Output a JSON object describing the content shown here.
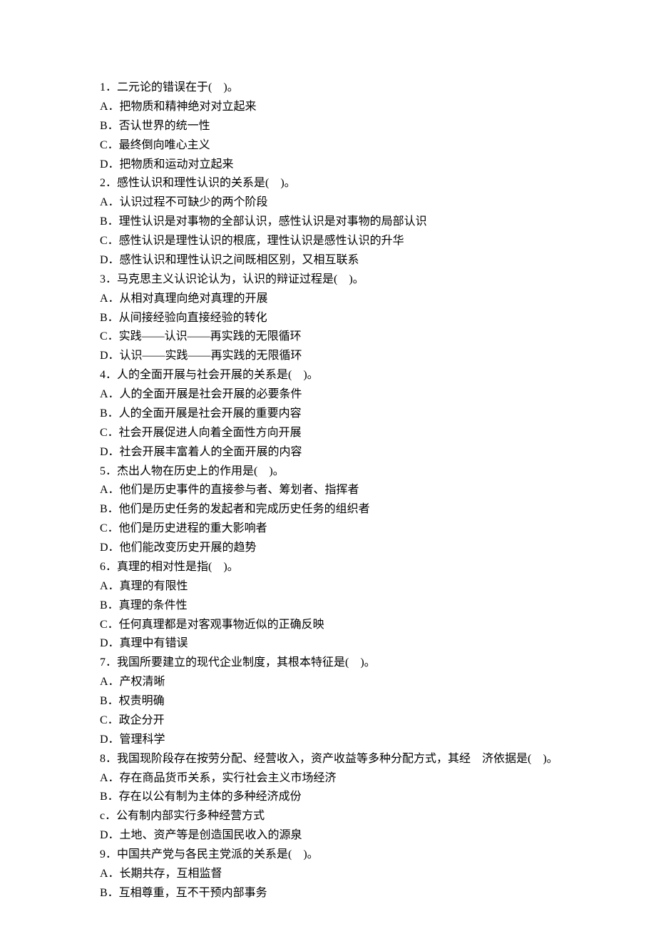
{
  "questions": [
    {
      "num": "1",
      "stem": "二元论的错误在于(　)。",
      "options": [
        {
          "label": "A",
          "text": "把物质和精神绝对对立起来"
        },
        {
          "label": "B",
          "text": "否认世界的统一性"
        },
        {
          "label": "C",
          "text": "最终倒向唯心主义"
        },
        {
          "label": "D",
          "text": "把物质和运动对立起来"
        }
      ]
    },
    {
      "num": "2",
      "stem": "感性认识和理性认识的关系是(　)。",
      "options": [
        {
          "label": "A",
          "text": "认识过程不可缺少的两个阶段"
        },
        {
          "label": "B",
          "text": "理性认识是对事物的全部认识，感性认识是对事物的局部认识"
        },
        {
          "label": "C",
          "text": "感性认识是理性认识的根底，理性认识是感性认识的升华"
        },
        {
          "label": "D",
          "text": "感性认识和理性认识之间既相区别，又相互联系"
        }
      ]
    },
    {
      "num": "3",
      "stem": "马克思主义认识论认为，认识的辩证过程是(　)。",
      "options": [
        {
          "label": "A",
          "text": "从相对真理向绝对真理的开展"
        },
        {
          "label": "B",
          "text": "从间接经验向直接经验的转化"
        },
        {
          "label": "C",
          "text": "实践——认识——再实践的无限循环"
        },
        {
          "label": "D",
          "text": "认识——实践——再实践的无限循环"
        }
      ]
    },
    {
      "num": "4",
      "stem": "人的全面开展与社会开展的关系是(　)。",
      "options": [
        {
          "label": "A",
          "text": "人的全面开展是社会开展的必要条件"
        },
        {
          "label": "B",
          "text": "人的全面开展是社会开展的重要内容"
        },
        {
          "label": "C",
          "text": "社会开展促进人向着全面性方向开展"
        },
        {
          "label": "D",
          "text": "社会开展丰富着人的全面开展的内容"
        }
      ]
    },
    {
      "num": "5",
      "stem": "杰出人物在历史上的作用是(　)。",
      "options": [
        {
          "label": "A",
          "text": "他们是历史事件的直接参与者、筹划者、指挥者"
        },
        {
          "label": "B",
          "text": "他们是历史任务的发起者和完成历史任务的组织者"
        },
        {
          "label": "C",
          "text": "他们是历史进程的重大影响者"
        },
        {
          "label": "D",
          "text": "他们能改变历史开展的趋势"
        }
      ]
    },
    {
      "num": "6",
      "stem": "真理的相对性是指(　)。",
      "options": [
        {
          "label": "A",
          "text": "真理的有限性"
        },
        {
          "label": "B",
          "text": "真理的条件性"
        },
        {
          "label": "C",
          "text": "任何真理都是对客观事物近似的正确反映"
        },
        {
          "label": "D",
          "text": "真理中有错误"
        }
      ]
    },
    {
      "num": "7",
      "stem": "我国所要建立的现代企业制度，其根本特征是(　)。",
      "options": [
        {
          "label": "A",
          "text": "产权清晰"
        },
        {
          "label": "B",
          "text": "权责明确"
        },
        {
          "label": "C",
          "text": "政企分开"
        },
        {
          "label": "D",
          "text": "管理科学"
        }
      ]
    },
    {
      "num": "8",
      "stem": "我国现阶段存在按劳分配、经营收入，资产收益等多种分配方式，其经　济依据是(　)。",
      "options": [
        {
          "label": "A",
          "text": "存在商品货币关系，实行社会主义市场经济"
        },
        {
          "label": "B",
          "text": "存在以公有制为主体的多种经济成份"
        },
        {
          "label": "c",
          "text": "公有制内部实行多种经营方式"
        },
        {
          "label": "D",
          "text": "土地、资产等是创造国民收入的源泉"
        }
      ]
    },
    {
      "num": "9",
      "stem": "中国共产党与各民主党派的关系是(　)。",
      "options": [
        {
          "label": "A",
          "text": "长期共存，互相监督"
        },
        {
          "label": "B",
          "text": "互相尊重，互不干预内部事务"
        }
      ]
    }
  ]
}
